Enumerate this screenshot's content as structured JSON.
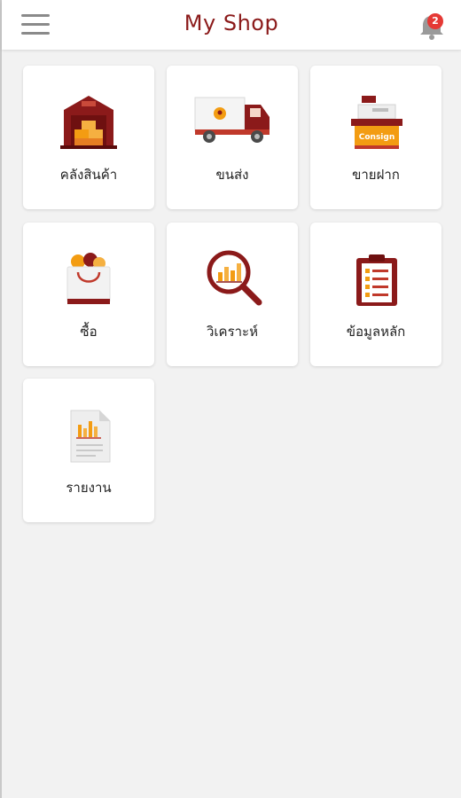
{
  "app": {
    "title": "My Shop"
  },
  "notifications": {
    "count": "2"
  },
  "menu": [
    {
      "id": "warehouse",
      "label": "คลังสินค้า",
      "icon": "warehouse-icon"
    },
    {
      "id": "shipping",
      "label": "ขนส่ง",
      "icon": "delivery-truck-icon"
    },
    {
      "id": "consign",
      "label": "ขายฝาก",
      "icon": "consign-counter-icon",
      "icon_text": "Consign"
    },
    {
      "id": "purchase",
      "label": "ซื้อ",
      "icon": "shopping-bag-icon"
    },
    {
      "id": "analysis",
      "label": "วิเคราะห์",
      "icon": "magnifier-chart-icon"
    },
    {
      "id": "master-data",
      "label": "ข้อมูลหลัก",
      "icon": "clipboard-icon"
    },
    {
      "id": "report",
      "label": "รายงาน",
      "icon": "report-document-icon"
    }
  ],
  "colors": {
    "title": "#8b1a1a",
    "accent_dark_red": "#8b1a1a",
    "accent_orange": "#f39c12",
    "badge": "#e53935"
  }
}
